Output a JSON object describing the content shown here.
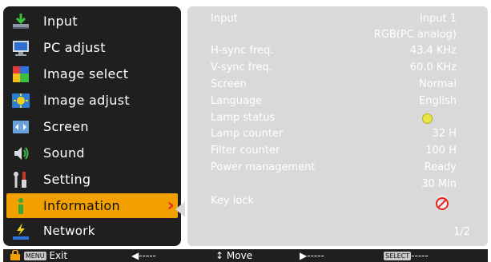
{
  "menu": {
    "items": [
      {
        "label": "Input",
        "icon": "input-icon"
      },
      {
        "label": "PC adjust",
        "icon": "pc-adjust-icon"
      },
      {
        "label": "Image select",
        "icon": "image-select-icon"
      },
      {
        "label": "Image adjust",
        "icon": "image-adjust-icon"
      },
      {
        "label": "Screen",
        "icon": "screen-icon"
      },
      {
        "label": "Sound",
        "icon": "sound-icon"
      },
      {
        "label": "Setting",
        "icon": "setting-icon"
      },
      {
        "label": "Information",
        "icon": "information-icon",
        "selected": true
      },
      {
        "label": "Network",
        "icon": "network-icon"
      }
    ]
  },
  "info": {
    "rows": [
      {
        "key": "Input",
        "value": "Input 1"
      },
      {
        "key": "",
        "value": "RGB(PC analog)"
      },
      {
        "key": "H-sync freq.",
        "value": "43.4 KHz"
      },
      {
        "key": "V-sync freq.",
        "value": "60.0 KHz"
      },
      {
        "key": "Screen",
        "value": "Normal"
      },
      {
        "key": "Language",
        "value": "English"
      },
      {
        "key": "Lamp status",
        "value": ""
      },
      {
        "key": "Lamp counter",
        "value": "32 H"
      },
      {
        "key": "Filter counter",
        "value": "100 H"
      },
      {
        "key": "Power management",
        "value": "Ready"
      },
      {
        "key": "",
        "value": "30 Min"
      },
      {
        "key": "Key lock",
        "value": ""
      }
    ],
    "page": "1/2"
  },
  "bottom": {
    "exit_key": "MENU",
    "exit": "Exit",
    "left_dashes": "-----",
    "move": "Move",
    "right_dashes": "-----",
    "select_key": "SELECT",
    "select_dashes": "-----"
  },
  "colors": {
    "menu_bg": "#1f1f1f",
    "selected": "#f2a000",
    "panel_bg": "#d9d9d9",
    "arrow": "#e8241b",
    "lamp_dot": "#e7e447"
  }
}
